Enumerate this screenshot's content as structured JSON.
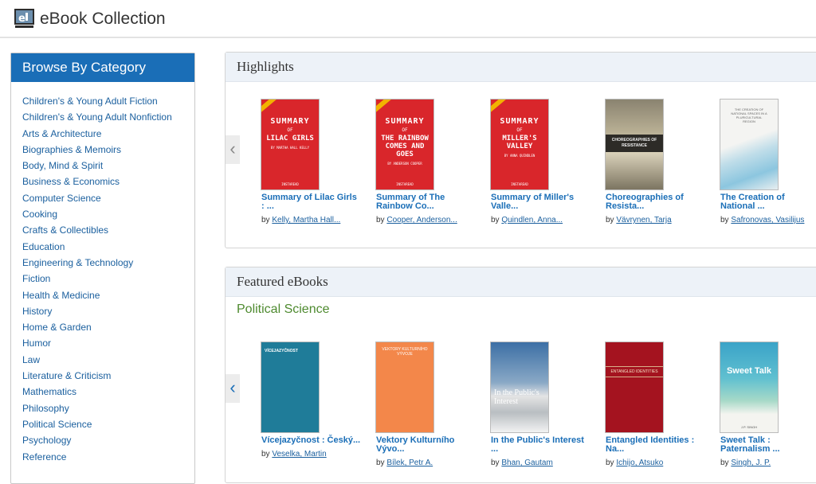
{
  "app": {
    "title": "eBook Collection",
    "logo_icon": "ebook-logo-icon"
  },
  "sidebar": {
    "heading": "Browse By Category",
    "items": [
      "Children's & Young Adult Fiction",
      "Children's & Young Adult Nonfiction",
      "Arts & Architecture",
      "Biographies & Memoirs",
      "Body, Mind & Spirit",
      "Business & Economics",
      "Computer Science",
      "Cooking",
      "Crafts & Collectibles",
      "Education",
      "Engineering & Technology",
      "Fiction",
      "Health & Medicine",
      "History",
      "Home & Garden",
      "Humor",
      "Law",
      "Literature & Criticism",
      "Mathematics",
      "Philosophy",
      "Political Science",
      "Psychology",
      "Reference"
    ]
  },
  "highlights": {
    "heading": "Highlights",
    "prev_icon": "chevron-left-icon",
    "books": [
      {
        "title": "Summary of Lilac Girls : ...",
        "by": "by",
        "author": "Kelly, Martha Hall...",
        "cover": {
          "kind": "summary",
          "l1": "SUMMARY",
          "l2": "OF",
          "l3": "LILAC GIRLS",
          "l4": "BY MARTHA HALL KELLY",
          "l5": "INSTAREAD"
        }
      },
      {
        "title": "Summary of The Rainbow Co...",
        "by": "by",
        "author": "Cooper, Anderson...",
        "cover": {
          "kind": "summary",
          "l1": "SUMMARY",
          "l2": "OF",
          "l3": "THE RAINBOW COMES AND GOES",
          "l4": "BY ANDERSON COOPER",
          "l5": "INSTAREAD"
        }
      },
      {
        "title": "Summary of Miller's Valle...",
        "by": "by",
        "author": "Quindlen, Anna...",
        "cover": {
          "kind": "summary",
          "l1": "SUMMARY",
          "l2": "OF",
          "l3": "MILLER'S VALLEY",
          "l4": "BY ANNA QUINDLEN",
          "l5": "INSTAREAD"
        }
      },
      {
        "title": "Choreographies of Resista...",
        "by": "by",
        "author": "Vävrynen, Tarja",
        "cover": {
          "kind": "choreo",
          "l1": "CHOREOGRAPHIES OF RESISTANCE"
        }
      },
      {
        "title": "The Creation of National ...",
        "by": "by",
        "author": "Safronovas, Vasilijus",
        "cover": {
          "kind": "creation",
          "l1": "THE CREATION OF NATIONAL SPACES IN A PLURICULTURAL REGION"
        }
      }
    ]
  },
  "featured": {
    "heading": "Featured eBooks",
    "subheading": "Political Science",
    "prev_icon": "chevron-left-icon",
    "books": [
      {
        "title": "Vícejazyčnost : Český...",
        "by": "by",
        "author": "Veselka, Martin",
        "cover": {
          "kind": "vice",
          "l1": "VÍCEJAZYČNOST"
        }
      },
      {
        "title": "Vektory Kulturního Vývo...",
        "by": "by",
        "author": "Bílek, Petr A.",
        "cover": {
          "kind": "vektory",
          "l1": "VEKTORY KULTURNÍHO VÝVOJE"
        }
      },
      {
        "title": "In the Public's Interest ...",
        "by": "by",
        "author": "Bhan, Gautam",
        "cover": {
          "kind": "public",
          "l1": "In the Public's Interest"
        }
      },
      {
        "title": "Entangled Identities : Na...",
        "by": "by",
        "author": "Ichijo, Atsuko",
        "cover": {
          "kind": "entangled",
          "l1": "ENTANGLED IDENTITIES"
        }
      },
      {
        "title": "Sweet Talk : Paternalism ...",
        "by": "by",
        "author": "Singh, J. P.",
        "cover": {
          "kind": "sweet",
          "l1": "Sweet Talk",
          "l2": "J.P. SINGH"
        }
      }
    ]
  },
  "colors": {
    "accent": "#1a6eb7",
    "subheading": "#4e8a2f",
    "summary_red": "#d9262b"
  }
}
